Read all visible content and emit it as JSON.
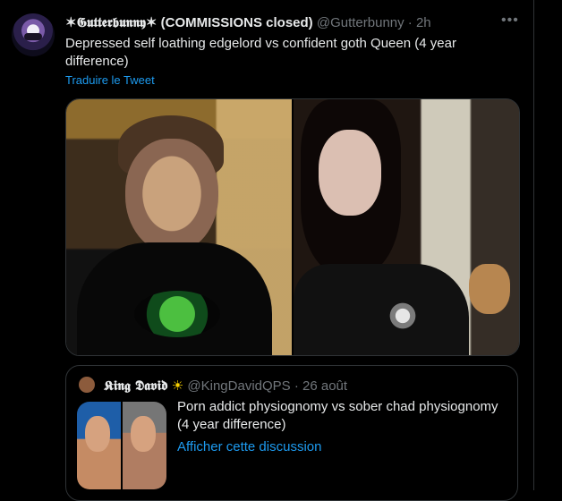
{
  "tweet": {
    "display_name": "✶𝕲𝖚𝖙𝖙𝖊𝖗𝖇𝖚𝖓𝖓𝖞✶ (COMMISSIONS closed)",
    "handle": "@Gutterbunny",
    "dot": "·",
    "time": "2h",
    "text": "Depressed self loathing edgelord vs confident goth Queen (4 year difference)",
    "translate_label": "Traduire le Tweet",
    "more_label": "•••"
  },
  "quote": {
    "display_name": "𝕶𝖎𝖓𝖌 𝕯𝖆𝖛𝖎𝖉",
    "emoji": "☀",
    "handle": "@KingDavidQPS",
    "dot": "·",
    "time": "26 août",
    "text": "Porn addict physiognomy vs sober chad physiognomy (4 year difference)",
    "link_label": "Afficher cette discussion"
  },
  "icons": {
    "more": "more-icon",
    "sun": "sun-icon"
  },
  "colors": {
    "background": "#000000",
    "text": "#e7e9ea",
    "muted": "#71767b",
    "accent": "#1d9bf0",
    "border": "#2f3336"
  }
}
